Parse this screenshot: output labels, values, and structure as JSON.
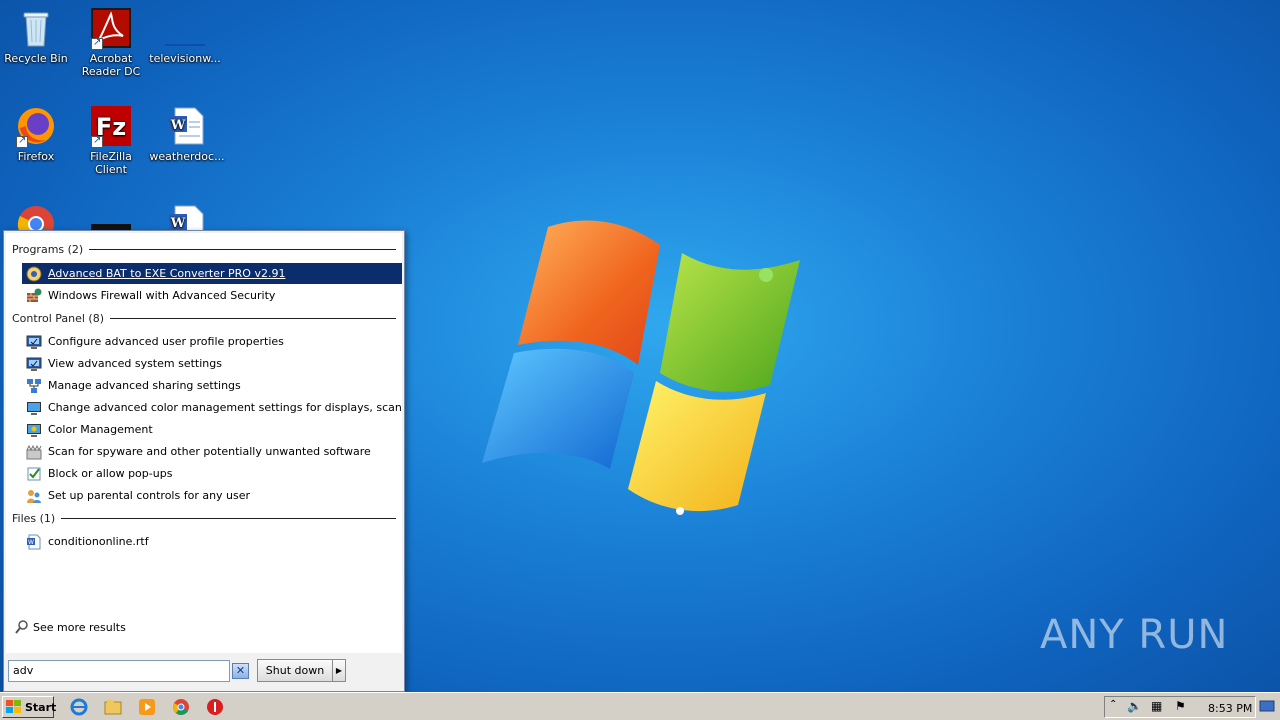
{
  "desktop": {
    "icons": [
      {
        "label": "Recycle Bin",
        "icon": "recycle-bin-icon"
      },
      {
        "label": "Acrobat Reader DC",
        "icon": "acrobat-icon"
      },
      {
        "label": "televisionw...",
        "icon": "blank-file-icon"
      },
      {
        "label": "Firefox",
        "icon": "firefox-icon"
      },
      {
        "label": "FileZilla Client",
        "icon": "filezilla-icon"
      },
      {
        "label": "weatherdoc...",
        "icon": "word-doc-icon"
      },
      {
        "label": "",
        "icon": "chrome-icon"
      },
      {
        "label": "",
        "icon": "black-app-icon"
      },
      {
        "label": "",
        "icon": "word-doc-icon"
      }
    ]
  },
  "start_menu": {
    "groups": {
      "programs": "Programs (2)",
      "control_panel": "Control Panel (8)",
      "files": "Files (1)"
    },
    "programs": [
      {
        "label": "Advanced BAT to EXE Converter PRO v2.91",
        "icon": "bat-converter-icon"
      },
      {
        "label": "Windows Firewall with Advanced Security",
        "icon": "firewall-icon"
      }
    ],
    "control_panel": [
      {
        "label": "Configure advanced user profile properties",
        "icon": "system-icon"
      },
      {
        "label": "View advanced system settings",
        "icon": "system-icon"
      },
      {
        "label": "Manage advanced sharing settings",
        "icon": "network-icon"
      },
      {
        "label": "Change advanced color management settings for displays, scanners, a...",
        "icon": "color-management-icon"
      },
      {
        "label": "Color Management",
        "icon": "color-management-icon"
      },
      {
        "label": "Scan for spyware and other potentially unwanted software",
        "icon": "defender-icon"
      },
      {
        "label": "Block or allow pop-ups",
        "icon": "internet-options-icon"
      },
      {
        "label": "Set up parental controls for any user",
        "icon": "parental-controls-icon"
      }
    ],
    "files": [
      {
        "label": "conditiononline.rtf",
        "icon": "rtf-file-icon"
      }
    ],
    "see_more": "See more results",
    "search_value": "adv",
    "shutdown_label": "Shut down"
  },
  "taskbar": {
    "start_label": "Start",
    "clock": "8:53 PM"
  },
  "watermark": "ANY RUN"
}
